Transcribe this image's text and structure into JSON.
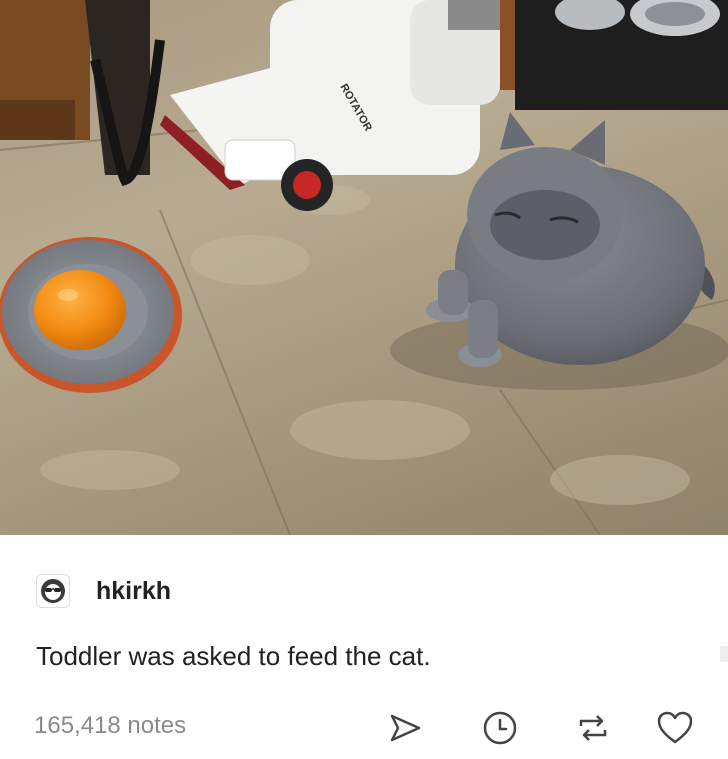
{
  "post": {
    "image_alt": "Gray cat sitting on a kitchen floor next to a plate holding an orange",
    "author": {
      "username": "hkirkh",
      "avatar_icon": "sunglasses-avatar-icon"
    },
    "caption": "Toddler was asked to feed the cat.",
    "notes": "165,418 notes",
    "vacuum_label": "ROTATOR",
    "actions": [
      {
        "name": "share",
        "icon": "share-icon"
      },
      {
        "name": "queue",
        "icon": "clock-icon"
      },
      {
        "name": "reblog",
        "icon": "reblog-icon"
      },
      {
        "name": "like",
        "icon": "heart-icon"
      }
    ]
  },
  "colors": {
    "text": "#222222",
    "muted": "#8a8a8a",
    "icon": "#444444",
    "background": "#ffffff"
  }
}
